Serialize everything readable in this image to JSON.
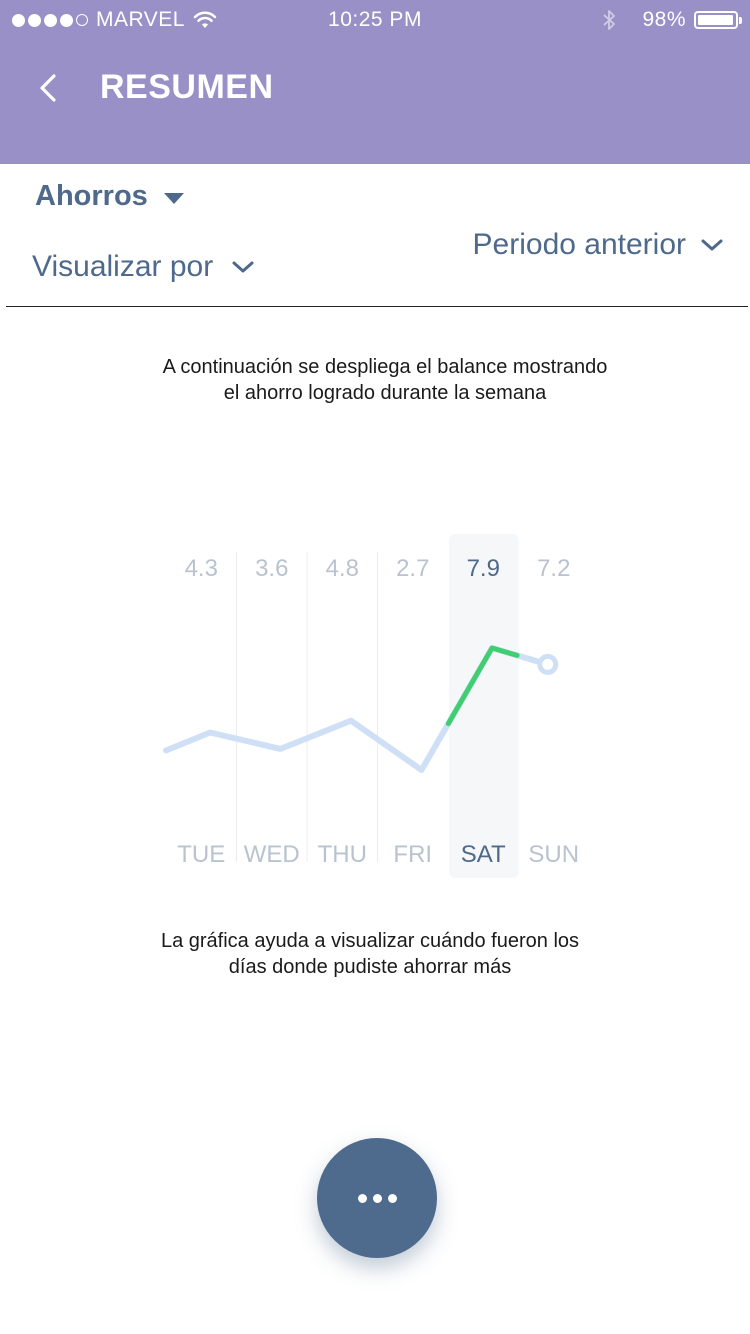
{
  "status_bar": {
    "carrier": "MARVEL",
    "time": "10:25 PM",
    "battery": "98%",
    "battery_level": 0.98
  },
  "header": {
    "title": "RESUMEN",
    "back_icon": "chevron-left-icon"
  },
  "controls": {
    "category": "Ahorros",
    "view_by": "Visualizar por",
    "period": "Periodo anterior"
  },
  "intro_text": {
    "line1": "A continuación se despliega el balance mostrando",
    "line2": "el ahorro logrado durante la semana"
  },
  "footer_text": {
    "line1": "La gráfica ayuda a visualizar cuándo fueron los",
    "line2": "días donde pudiste ahorrar más"
  },
  "fab": {
    "icon": "more-horizontal-icon"
  },
  "colors": {
    "header_bg": "#9890c6",
    "primary_text": "#4e698b",
    "muted_text": "#b9c3d0",
    "line": "#cfe0f6",
    "highlight_line": "#3fcf71",
    "selected_column_bg": "#f5f7f9",
    "fab_bg": "#4e6a8c"
  },
  "chart_data": {
    "type": "line",
    "categories": [
      "TUE",
      "WED",
      "THU",
      "FRI",
      "SAT",
      "SUN"
    ],
    "values": [
      4.3,
      3.6,
      4.8,
      2.7,
      7.9,
      7.2
    ],
    "selected_index": 4,
    "highlight_segment": [
      "FRI",
      "SAT"
    ],
    "grid": "vertical"
  }
}
